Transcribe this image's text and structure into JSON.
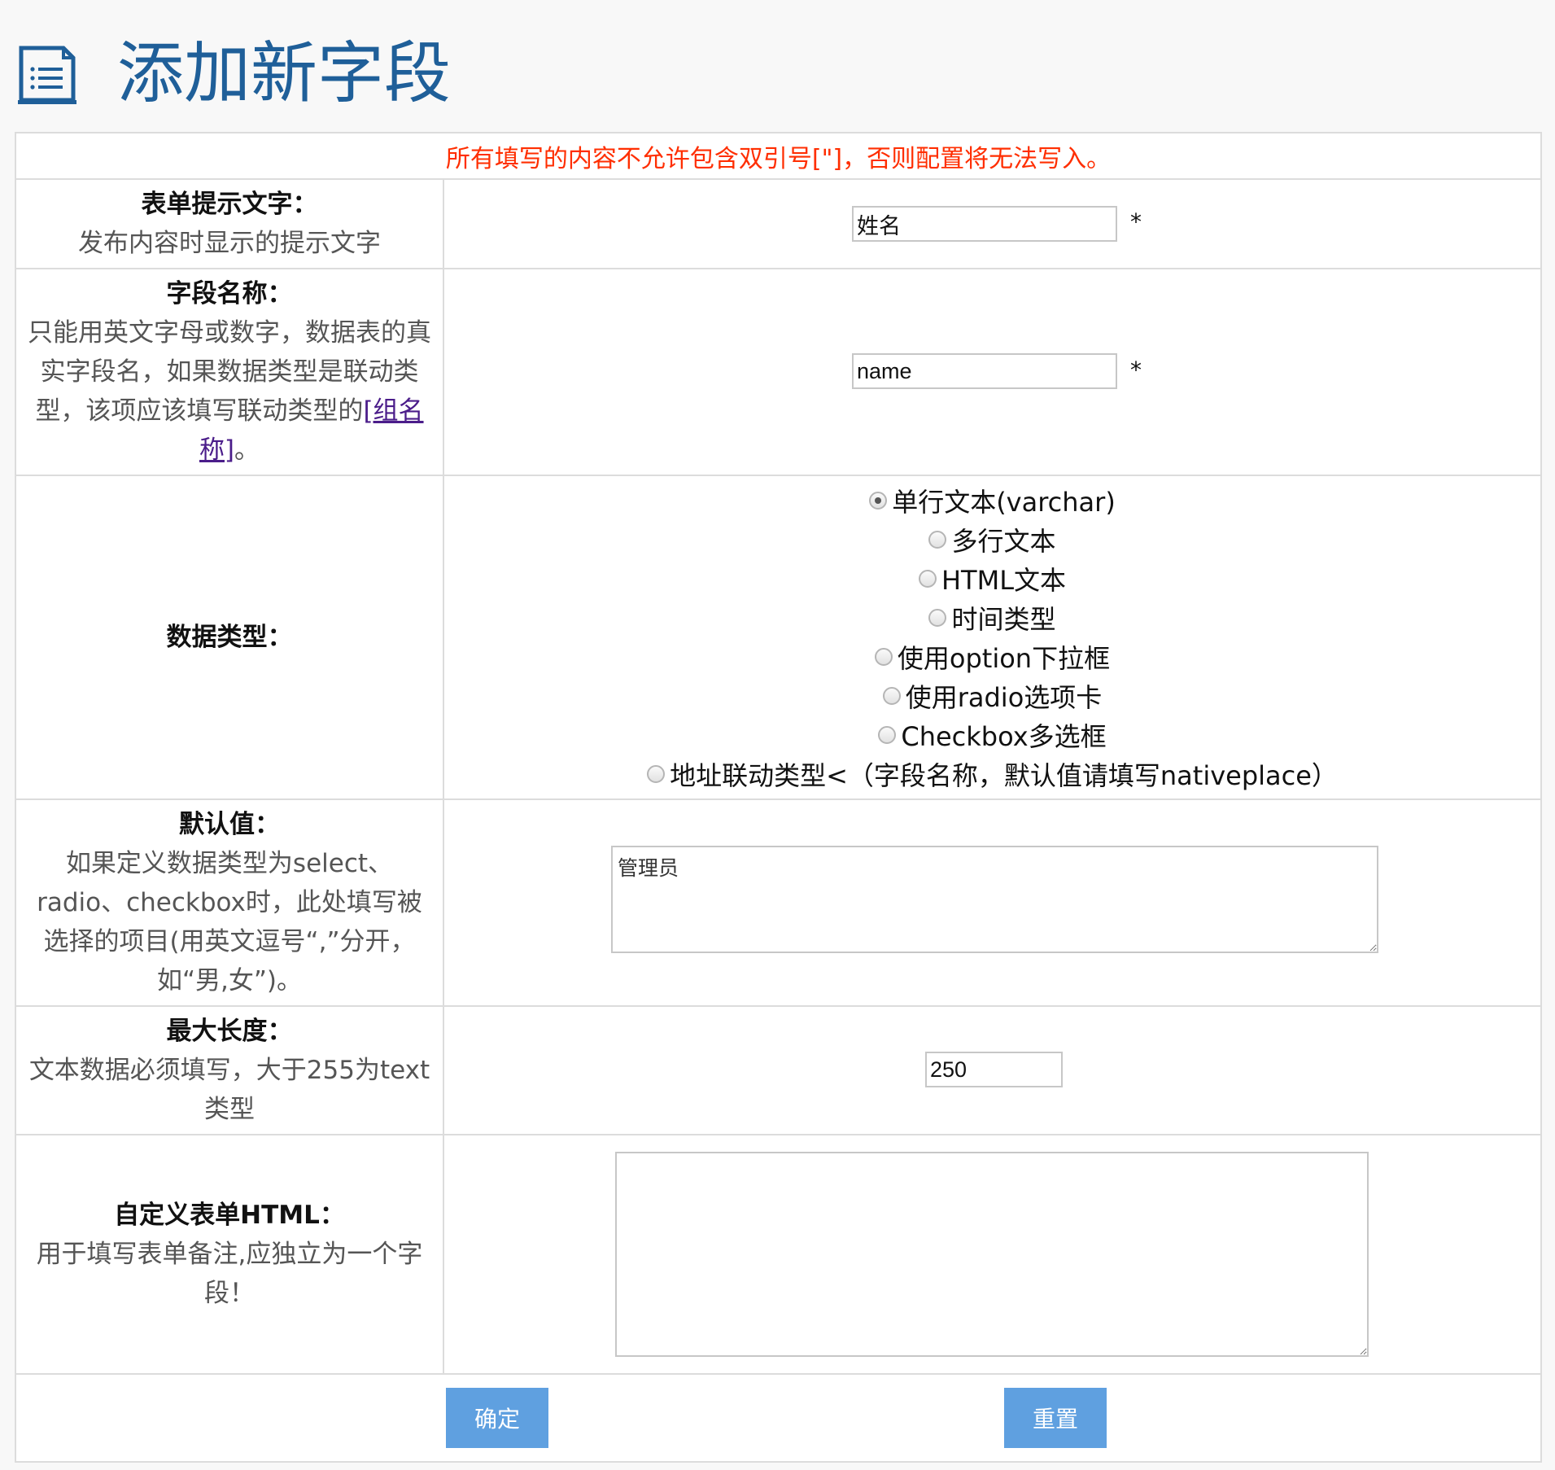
{
  "header": {
    "icon": "document-list-icon",
    "title": "添加新字段"
  },
  "notice": "所有填写的内容不允许包含双引号[\"]，否则配置将无法写入。",
  "fields": {
    "prompt_text": {
      "label": "表单提示文字：",
      "description": "发布内容时显示的提示文字",
      "value": "姓名",
      "required_mark": "*"
    },
    "field_name": {
      "label": "字段名称：",
      "description": "只能用英文字母或数字，数据表的真实字段名，如果数据类型是联动类型，该项应该填写联动类型的",
      "link_text": "[组名称]",
      "description_suffix": "。",
      "value": "name",
      "required_mark": "*"
    },
    "data_type": {
      "label": "数据类型：",
      "options": [
        {
          "label": "单行文本(varchar)",
          "checked": true
        },
        {
          "label": "多行文本",
          "checked": false
        },
        {
          "label": "HTML文本",
          "checked": false
        },
        {
          "label": "时间类型",
          "checked": false
        },
        {
          "label": "使用option下拉框",
          "checked": false
        },
        {
          "label": "使用radio选项卡",
          "checked": false
        },
        {
          "label": "Checkbox多选框",
          "checked": false
        },
        {
          "label": "地址联动类型<（字段名称，默认值请填写nativeplace）",
          "checked": false
        }
      ]
    },
    "default_value": {
      "label": "默认值：",
      "description": "如果定义数据类型为select、radio、checkbox时，此处填写被选择的项目(用英文逗号“,”分开，如“男,女”)。",
      "value": "管理员"
    },
    "max_length": {
      "label": "最大长度：",
      "description": "文本数据必须填写，大于255为text类型",
      "value": "250"
    },
    "custom_html": {
      "label": "自定义表单HTML：",
      "description": "用于填写表单备注,应独立为一个字段！",
      "value": ""
    }
  },
  "buttons": {
    "submit": "确定",
    "reset": "重置"
  },
  "colors": {
    "title": "#1f5f99",
    "notice": "#ff2e00",
    "button": "#5fa0e0"
  }
}
